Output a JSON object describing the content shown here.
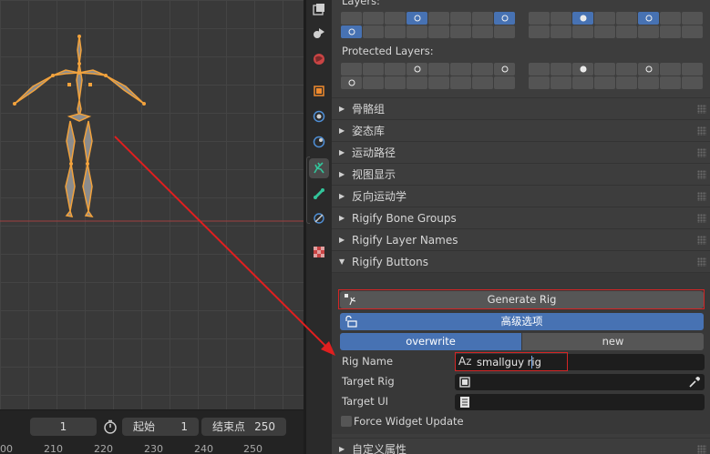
{
  "layers": {
    "label_top": "Layers:",
    "protected_label": "Protected Layers:"
  },
  "panels": [
    {
      "label": "骨骼组"
    },
    {
      "label": "姿态库"
    },
    {
      "label": "运动路径"
    },
    {
      "label": "视图显示"
    },
    {
      "label": "反向运动学"
    },
    {
      "label": "Rigify Bone Groups"
    },
    {
      "label": "Rigify Layer Names"
    },
    {
      "label": "Rigify Buttons"
    }
  ],
  "rigify": {
    "generate_rig": "Generate Rig",
    "advanced": "高级选项",
    "overwrite": "overwrite",
    "new": "new",
    "rig_name_label": "Rig Name",
    "rig_name_value": "smallguy rig",
    "target_rig_label": "Target Rig",
    "target_ui_label": "Target UI",
    "force_widget": "Force Widget Update"
  },
  "custom_props": "自定义属性",
  "timeline": {
    "current_frame": "1",
    "start_label": "起始",
    "start_value": "1",
    "end_label": "结束点",
    "end_value": "250",
    "ruler": [
      "00",
      "210",
      "220",
      "230",
      "240",
      "250"
    ]
  },
  "colors": {
    "accent": "#4772b3",
    "highlight_box": "#d42525",
    "bone": "#f0a040"
  }
}
